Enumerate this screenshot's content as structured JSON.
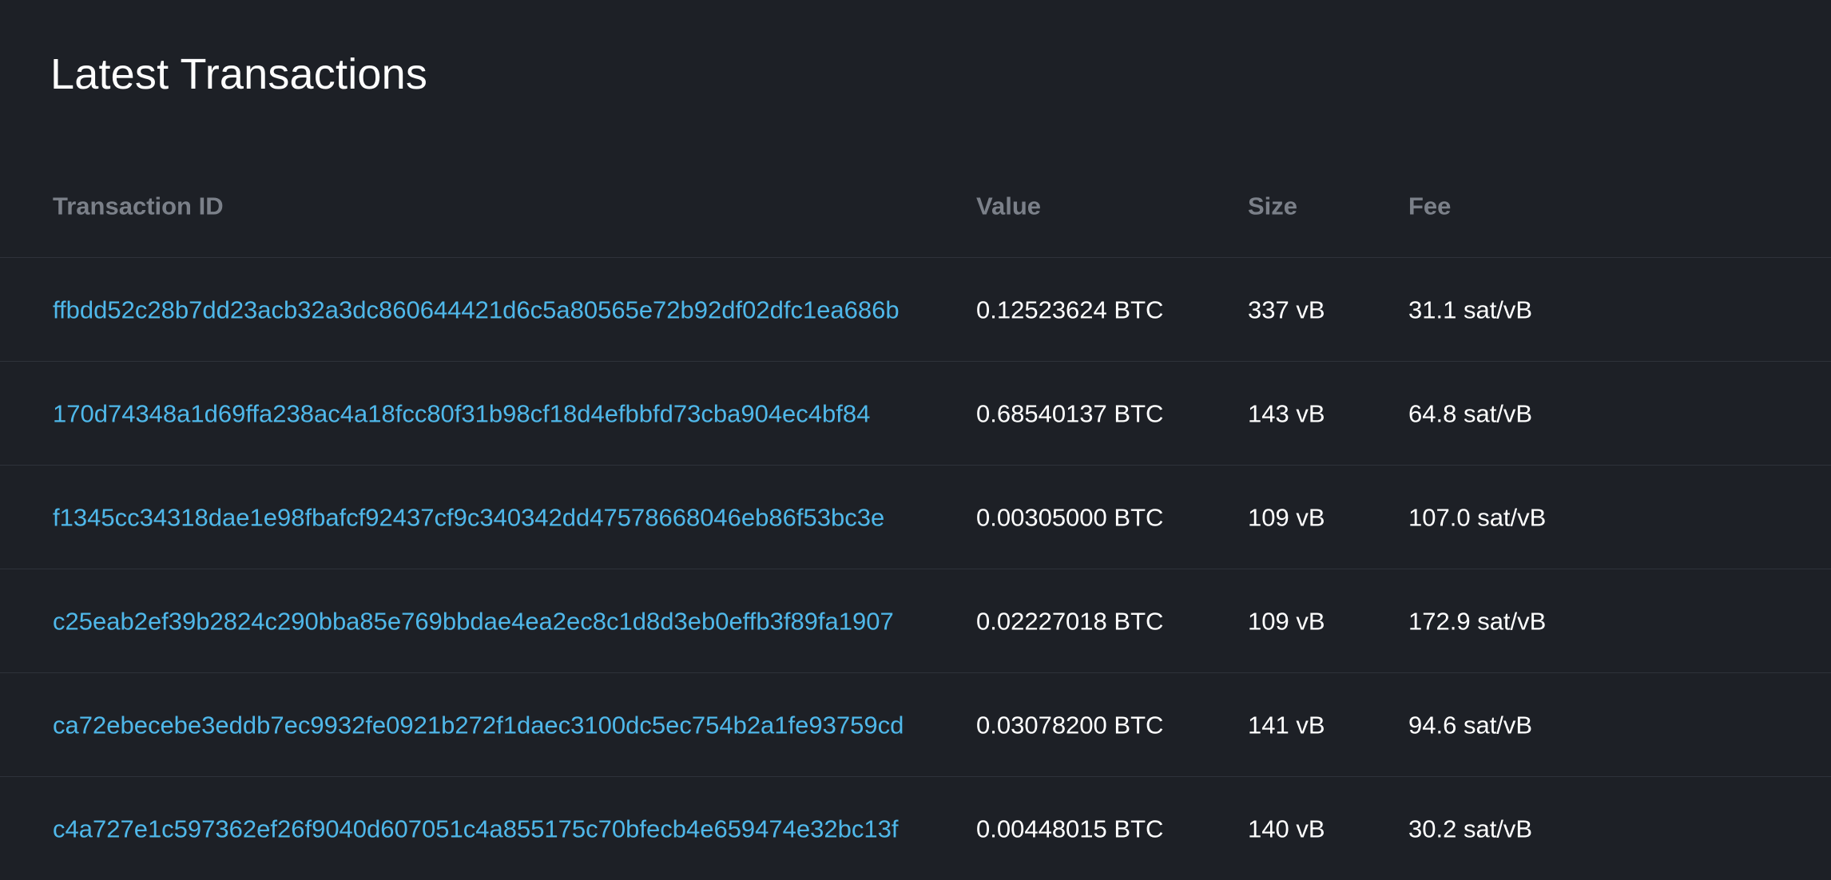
{
  "title": "Latest Transactions",
  "columns": {
    "txid": "Transaction ID",
    "value": "Value",
    "size": "Size",
    "fee": "Fee"
  },
  "colors": {
    "background": "#1d2026",
    "link": "#4fb8ea",
    "header_text": "#7b8089",
    "row_divider": "#2e323a"
  },
  "rows": [
    {
      "txid": "ffbdd52c28b7dd23acb32a3dc860644421d6c5a80565e72b92df02dfc1ea686b",
      "value": "0.12523624 BTC",
      "size": "337 vB",
      "fee": "31.1 sat/vB"
    },
    {
      "txid": "170d74348a1d69ffa238ac4a18fcc80f31b98cf18d4efbbfd73cba904ec4bf84",
      "value": "0.68540137 BTC",
      "size": "143 vB",
      "fee": "64.8 sat/vB"
    },
    {
      "txid": "f1345cc34318dae1e98fbafcf92437cf9c340342dd47578668046eb86f53bc3e",
      "value": "0.00305000 BTC",
      "size": "109 vB",
      "fee": "107.0 sat/vB"
    },
    {
      "txid": "c25eab2ef39b2824c290bba85e769bbdae4ea2ec8c1d8d3eb0effb3f89fa1907",
      "value": "0.02227018 BTC",
      "size": "109 vB",
      "fee": "172.9 sat/vB"
    },
    {
      "txid": "ca72ebecebe3eddb7ec9932fe0921b272f1daec3100dc5ec754b2a1fe93759cd",
      "value": "0.03078200 BTC",
      "size": "141 vB",
      "fee": "94.6 sat/vB"
    },
    {
      "txid": "c4a727e1c597362ef26f9040d607051c4a855175c70bfecb4e659474e32bc13f",
      "value": "0.00448015 BTC",
      "size": "140 vB",
      "fee": "30.2 sat/vB"
    }
  ]
}
